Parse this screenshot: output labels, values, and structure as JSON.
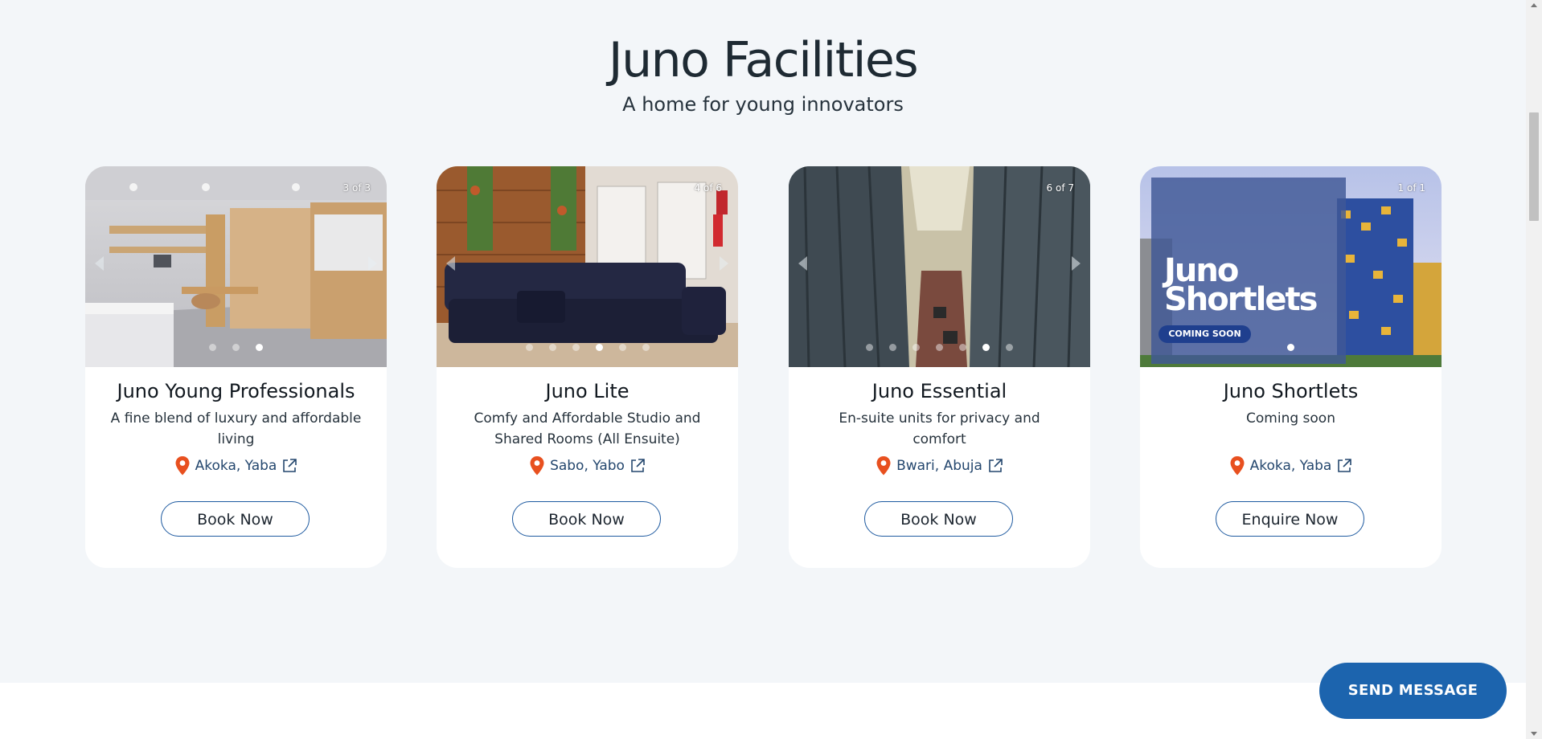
{
  "header": {
    "title": "Juno Facilities",
    "subtitle": "A home for young innovators"
  },
  "cards": [
    {
      "name": "Juno Young Professionals",
      "description": "A fine blend of luxury and affordable living",
      "location": "Akoka, Yaba",
      "counter": "3 of 3",
      "slides": 3,
      "active_slide": 3,
      "button": "Book Now",
      "image": "studio-apartment-interior"
    },
    {
      "name": "Juno Lite",
      "description": "Comfy and Affordable Studio and Shared Rooms (All Ensuite)",
      "location": "Sabo, Yabo",
      "counter": "4 of 6",
      "slides": 6,
      "active_slide": 4,
      "button": "Book Now",
      "image": "lounge-with-sectional-sofa"
    },
    {
      "name": "Juno Essential",
      "description": "En-suite units for privacy and comfort",
      "location": "Bwari, Abuja",
      "counter": "6 of 7",
      "slides": 7,
      "active_slide": 6,
      "button": "Book Now",
      "image": "atrium-building-interior"
    },
    {
      "name": "Juno Shortlets",
      "description": "Coming soon",
      "location": "Akoka, Yaba",
      "counter": "1 of 1",
      "slides": 1,
      "active_slide": 1,
      "button": "Enquire Now",
      "image": "shortlets-promo-building",
      "promo": {
        "line1": "Juno",
        "line2": "Shortlets",
        "badge": "COMING SOON"
      }
    }
  ],
  "chat": {
    "label": "SEND MESSAGE"
  },
  "colors": {
    "accent": "#1c64ae",
    "pin": "#e8501f",
    "location_text": "#24476e",
    "button_border": "#1e5aa0",
    "background": "#f3f6f9"
  }
}
